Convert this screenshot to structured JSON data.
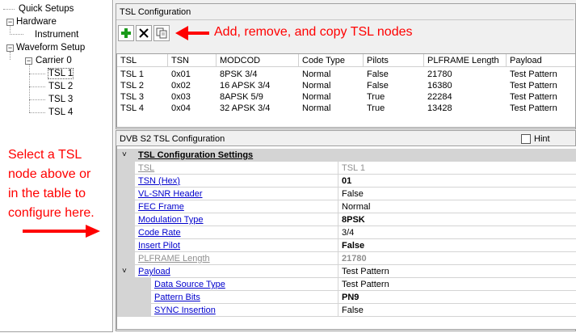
{
  "tree": {
    "items": [
      {
        "label": "Quick Setups"
      },
      {
        "label": "Hardware"
      },
      {
        "label": "Instrument"
      },
      {
        "label": "Waveform Setup"
      },
      {
        "label": "Carrier 0"
      },
      {
        "label": "TSL 1"
      },
      {
        "label": "TSL 2"
      },
      {
        "label": "TSL 3"
      },
      {
        "label": "TSL 4"
      }
    ]
  },
  "tsl_config": {
    "title": "TSL Configuration",
    "toolbar": {
      "add_icon": "plus-icon",
      "remove_icon": "x-icon",
      "copy_icon": "copy-icon"
    },
    "annotation": "Add, remove, and copy TSL nodes",
    "table": {
      "columns": [
        "TSL",
        "TSN",
        "MODCOD",
        "Code Type",
        "Pilots",
        "PLFRAME Length",
        "Payload"
      ],
      "rows": [
        [
          "TSL 1",
          "0x01",
          "8PSK 3/4",
          "Normal",
          "False",
          "21780",
          "Test Pattern"
        ],
        [
          "TSL 2",
          "0x02",
          "16 APSK 3/4",
          "Normal",
          "False",
          "16380",
          "Test Pattern"
        ],
        [
          "TSL 3",
          "0x03",
          "8APSK 5/9",
          "Normal",
          "True",
          "22284",
          "Test Pattern"
        ],
        [
          "TSL 4",
          "0x04",
          "32 APSK 3/4",
          "Normal",
          "True",
          "13428",
          "Test Pattern"
        ]
      ]
    }
  },
  "dvb": {
    "title": "DVB S2 TSL Configuration",
    "hint_label": "Hint",
    "hint_checked": false,
    "category1": "TSL Configuration Settings",
    "props": [
      {
        "name": "TSL",
        "value": "TSL 1"
      },
      {
        "name": "TSN (Hex)",
        "value": "01"
      },
      {
        "name": "VL-SNR Header",
        "value": "False"
      },
      {
        "name": "FEC Frame",
        "value": "Normal"
      },
      {
        "name": "Modulation Type",
        "value": "8PSK"
      },
      {
        "name": "Code Rate",
        "value": "3/4"
      },
      {
        "name": "Insert Pilot",
        "value": "False"
      },
      {
        "name": "PLFRAME Length",
        "value": "21780"
      }
    ],
    "payload": {
      "name": "Payload",
      "value": "Test Pattern"
    },
    "subprops": [
      {
        "name": "Data Source Type",
        "value": "Test Pattern"
      },
      {
        "name": "Pattern Bits",
        "value": "PN9"
      },
      {
        "name": "SYNC Insertion",
        "value": "False"
      }
    ]
  },
  "left_annotation": {
    "lines": [
      "Select a TSL",
      "node above or",
      "in the table to",
      "configure here."
    ]
  },
  "colors": {
    "annotation": "#ff0000",
    "link": "#0000cc",
    "margin": "#d4d4d4"
  }
}
